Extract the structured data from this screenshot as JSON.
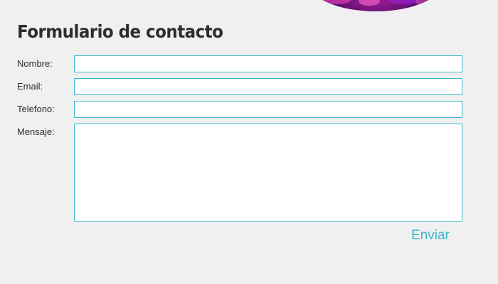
{
  "form": {
    "title": "Formulario de contacto",
    "fields": [
      {
        "label": "Nombre:",
        "value": "",
        "placeholder": ""
      },
      {
        "label": "Email:",
        "value": "",
        "placeholder": ""
      },
      {
        "label": "Telefono:",
        "value": "",
        "placeholder": ""
      },
      {
        "label": "Mensaje:",
        "value": "",
        "placeholder": ""
      }
    ],
    "submit_label": "Enviar"
  },
  "colors": {
    "background": "#f0f0f0",
    "accent": "#3ab7cd",
    "text": "#2d2d2d",
    "input_background": "#ffffff"
  }
}
